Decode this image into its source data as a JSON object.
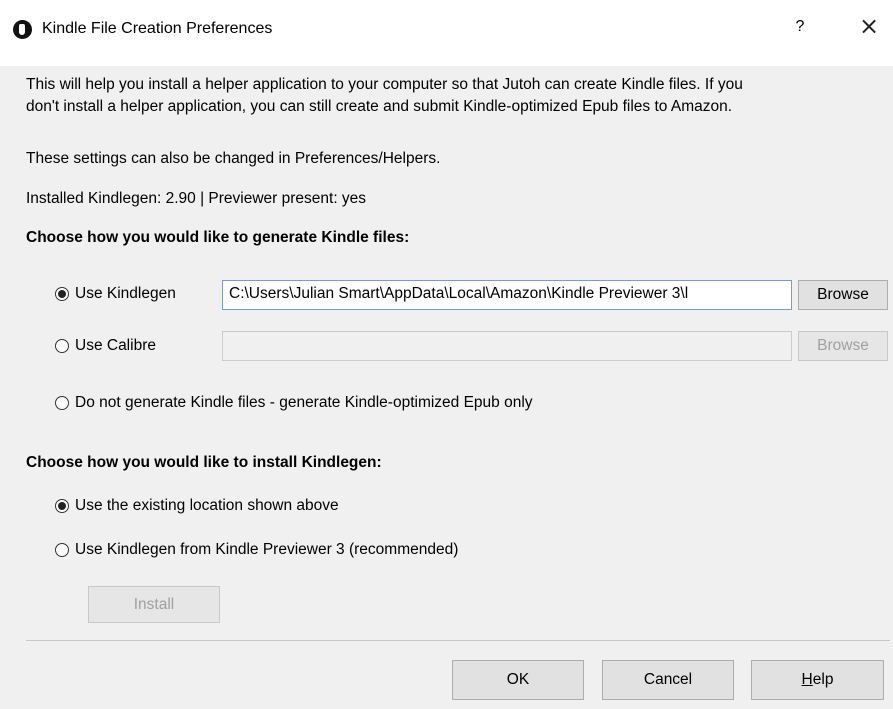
{
  "window": {
    "title": "Kindle File Creation Preferences",
    "help_glyph": "?",
    "close_glyph": "×"
  },
  "intro": {
    "line1": "This will help you install a helper application to your computer so that Jutoh can create Kindle files. If you",
    "line2": "don't install a helper application, you can still create and submit Kindle-optimized Epub files to Amazon.",
    "settings_note": "These settings can also be changed in Preferences/Helpers.",
    "installed_status": "Installed Kindlegen: 2.90 | Previewer present: yes"
  },
  "generate_section": {
    "heading": "Choose how you would like to generate Kindle files:",
    "options": [
      {
        "label": "Use Kindlegen",
        "checked": true
      },
      {
        "label": "Use Calibre",
        "checked": false
      },
      {
        "label": "Do not generate Kindle files - generate Kindle-optimized Epub only",
        "checked": false
      }
    ],
    "kindlegen_path": "C:\\Users\\Julian Smart\\AppData\\Local\\Amazon\\Kindle Previewer 3\\l",
    "calibre_path": "",
    "browse_label": "Browse",
    "browse_disabled_label": "Browse"
  },
  "install_section": {
    "heading": "Choose how you would like to install Kindlegen:",
    "options": [
      {
        "label": "Use the existing location shown above",
        "checked": true
      },
      {
        "label": "Use Kindlegen from Kindle Previewer 3 (recommended)",
        "checked": false
      }
    ],
    "install_label": "Install"
  },
  "footer": {
    "ok_label": "OK",
    "cancel_label": "Cancel",
    "help_label_prefix": "",
    "help_label_underlined": "H",
    "help_label_rest": "elp"
  }
}
